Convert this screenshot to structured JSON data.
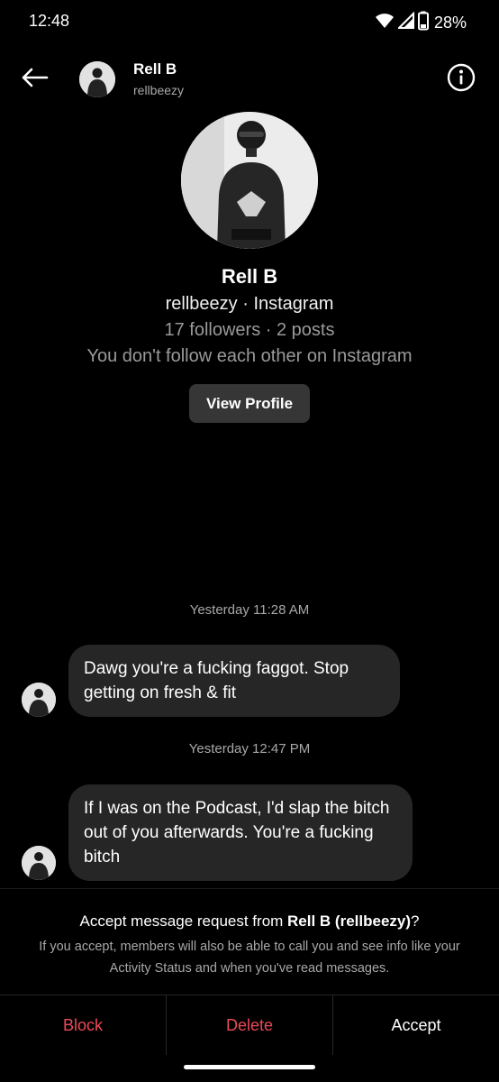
{
  "status_bar": {
    "time": "12:48",
    "battery": "28%",
    "icons": [
      "wifi-icon",
      "cell-signal-icon",
      "battery-icon"
    ]
  },
  "header": {
    "name": "Rell B",
    "username": "rellbeezy",
    "back_icon": "arrow-left-icon",
    "info_icon": "info-icon"
  },
  "profile": {
    "name": "Rell B",
    "handle_line": "rellbeezy · Instagram",
    "stats_line": "17 followers · 2 posts",
    "follow_line": "You don't follow each other on Instagram",
    "view_profile_label": "View Profile"
  },
  "thread": {
    "messages": [
      {
        "timestamp": "Yesterday 11:28 AM",
        "text": "Dawg you're a fucking faggot. Stop getting on fresh & fit"
      },
      {
        "timestamp": "Yesterday 12:47 PM",
        "text": "If I was on the Podcast, I'd slap the bitch out of you afterwards. You're a fucking bitch"
      }
    ]
  },
  "request": {
    "title_prefix": "Accept message request from ",
    "title_name": "Rell B (rellbeezy)",
    "title_suffix": "?",
    "description": "If you accept, members will also be able to call you and see info like your Activity Status and when you've read messages."
  },
  "actions": {
    "block": "Block",
    "delete": "Delete",
    "accept": "Accept"
  },
  "colors": {
    "background": "#000000",
    "bubble": "#262626",
    "destructive": "#ed4956",
    "secondary_text": "#a8a8a8"
  }
}
